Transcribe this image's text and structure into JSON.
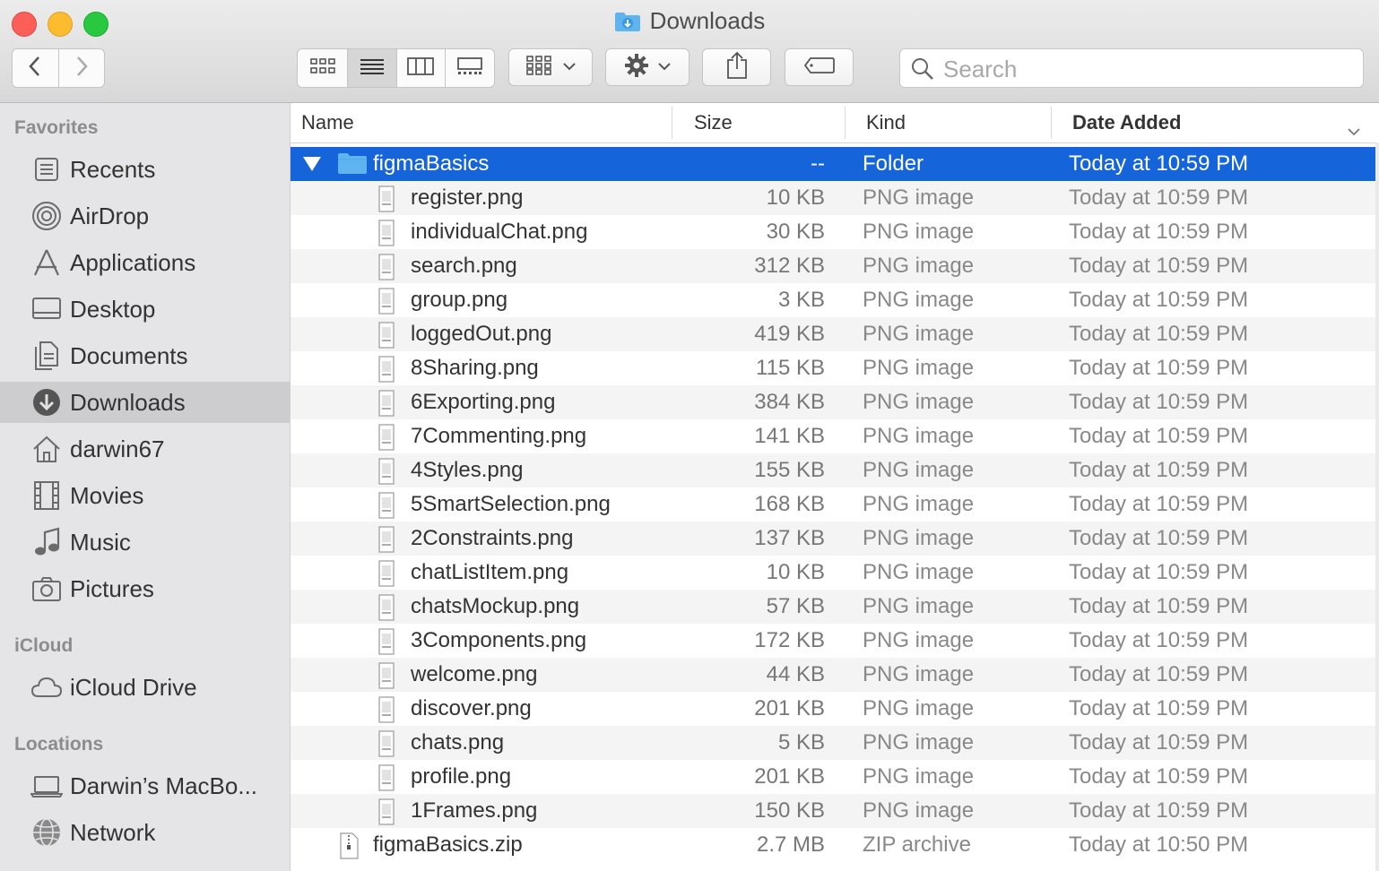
{
  "window": {
    "title": "Downloads"
  },
  "toolbar": {
    "back_icon": "chevron-left-icon",
    "forward_icon": "chevron-right-icon",
    "view_modes": [
      "icon-view-icon",
      "list-view-icon",
      "column-view-icon",
      "gallery-view-icon"
    ],
    "active_view": "list",
    "group_icon": "group-by-icon",
    "action_icon": "gear-icon",
    "share_icon": "share-icon",
    "tag_icon": "tag-icon",
    "search_placeholder": "Search"
  },
  "sidebar": {
    "favorites_heading": "Favorites",
    "favorites": [
      {
        "label": "Recents",
        "icon": "recents-icon"
      },
      {
        "label": "AirDrop",
        "icon": "airdrop-icon"
      },
      {
        "label": "Applications",
        "icon": "applications-icon"
      },
      {
        "label": "Desktop",
        "icon": "desktop-icon"
      },
      {
        "label": "Documents",
        "icon": "documents-icon"
      },
      {
        "label": "Downloads",
        "icon": "downloads-icon",
        "selected": true
      },
      {
        "label": "darwin67",
        "icon": "home-icon"
      },
      {
        "label": "Movies",
        "icon": "movies-icon"
      },
      {
        "label": "Music",
        "icon": "music-icon"
      },
      {
        "label": "Pictures",
        "icon": "pictures-icon"
      }
    ],
    "icloud_heading": "iCloud",
    "icloud": [
      {
        "label": "iCloud Drive",
        "icon": "cloud-icon"
      }
    ],
    "locations_heading": "Locations",
    "locations": [
      {
        "label": "Darwin’s MacBo...",
        "icon": "laptop-icon"
      },
      {
        "label": "Network",
        "icon": "network-icon"
      }
    ]
  },
  "columns": {
    "name": "Name",
    "size": "Size",
    "kind": "Kind",
    "date": "Date Added"
  },
  "files": [
    {
      "name": "figmaBasics",
      "size": "--",
      "kind": "Folder",
      "date": "Today at 10:59 PM",
      "type": "folder",
      "expanded": true,
      "selected": true
    },
    {
      "name": "register.png",
      "size": "10 KB",
      "kind": "PNG image",
      "date": "Today at 10:59 PM",
      "type": "png"
    },
    {
      "name": "individualChat.png",
      "size": "30 KB",
      "kind": "PNG image",
      "date": "Today at 10:59 PM",
      "type": "png"
    },
    {
      "name": "search.png",
      "size": "312 KB",
      "kind": "PNG image",
      "date": "Today at 10:59 PM",
      "type": "png"
    },
    {
      "name": "group.png",
      "size": "3 KB",
      "kind": "PNG image",
      "date": "Today at 10:59 PM",
      "type": "png"
    },
    {
      "name": "loggedOut.png",
      "size": "419 KB",
      "kind": "PNG image",
      "date": "Today at 10:59 PM",
      "type": "png"
    },
    {
      "name": "8Sharing.png",
      "size": "115 KB",
      "kind": "PNG image",
      "date": "Today at 10:59 PM",
      "type": "png"
    },
    {
      "name": "6Exporting.png",
      "size": "384 KB",
      "kind": "PNG image",
      "date": "Today at 10:59 PM",
      "type": "png"
    },
    {
      "name": "7Commenting.png",
      "size": "141 KB",
      "kind": "PNG image",
      "date": "Today at 10:59 PM",
      "type": "png"
    },
    {
      "name": "4Styles.png",
      "size": "155 KB",
      "kind": "PNG image",
      "date": "Today at 10:59 PM",
      "type": "png"
    },
    {
      "name": "5SmartSelection.png",
      "size": "168 KB",
      "kind": "PNG image",
      "date": "Today at 10:59 PM",
      "type": "png"
    },
    {
      "name": "2Constraints.png",
      "size": "137 KB",
      "kind": "PNG image",
      "date": "Today at 10:59 PM",
      "type": "png"
    },
    {
      "name": "chatListItem.png",
      "size": "10 KB",
      "kind": "PNG image",
      "date": "Today at 10:59 PM",
      "type": "png"
    },
    {
      "name": "chatsMockup.png",
      "size": "57 KB",
      "kind": "PNG image",
      "date": "Today at 10:59 PM",
      "type": "png"
    },
    {
      "name": "3Components.png",
      "size": "172 KB",
      "kind": "PNG image",
      "date": "Today at 10:59 PM",
      "type": "png"
    },
    {
      "name": "welcome.png",
      "size": "44 KB",
      "kind": "PNG image",
      "date": "Today at 10:59 PM",
      "type": "png"
    },
    {
      "name": "discover.png",
      "size": "201 KB",
      "kind": "PNG image",
      "date": "Today at 10:59 PM",
      "type": "png"
    },
    {
      "name": "chats.png",
      "size": "5 KB",
      "kind": "PNG image",
      "date": "Today at 10:59 PM",
      "type": "png"
    },
    {
      "name": "profile.png",
      "size": "201 KB",
      "kind": "PNG image",
      "date": "Today at 10:59 PM",
      "type": "png"
    },
    {
      "name": "1Frames.png",
      "size": "150 KB",
      "kind": "PNG image",
      "date": "Today at 10:59 PM",
      "type": "png"
    },
    {
      "name": "figmaBasics.zip",
      "size": "2.7 MB",
      "kind": "ZIP archive",
      "date": "Today at 10:50 PM",
      "type": "zip"
    }
  ],
  "colors": {
    "selection": "#1664d9",
    "sidebar_bg": "#e5e4e6",
    "folder": "#5fb4f0"
  }
}
